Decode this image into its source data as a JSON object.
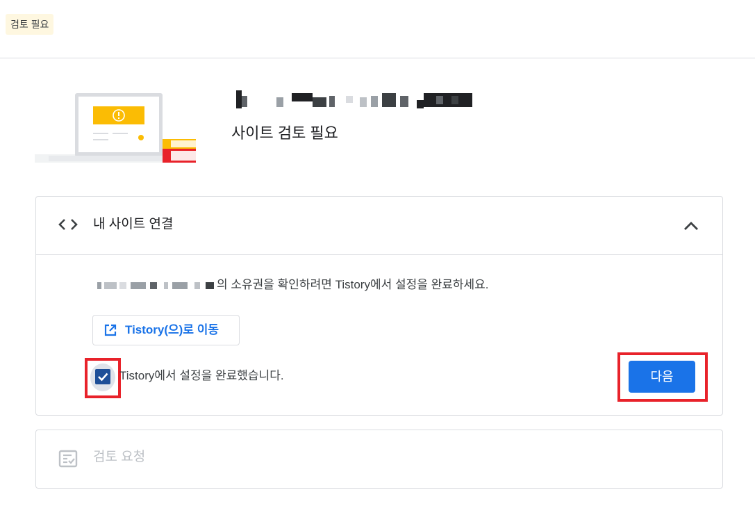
{
  "header": {
    "status_chip": "검토 필요"
  },
  "hero": {
    "title": "사이트 검토 필요",
    "illustration": "laptop-warning-with-books"
  },
  "connect_card": {
    "title": "내 사이트 연결",
    "icon": "code-icon",
    "collapse_icon": "chevron-up-icon",
    "instruction_suffix": "의 소유권을 확인하려면 Tistory에서 설정을 완료하세요.",
    "goto_button_label": "Tistory(으)로 이동",
    "checkbox_label": "Tistory에서 설정을 완료했습니다.",
    "checkbox_checked": true,
    "next_button_label": "다음"
  },
  "review_card": {
    "title": "검토 요청",
    "icon": "review-request-icon",
    "disabled": true
  },
  "colors": {
    "primary": "#1a73e8",
    "checkbox": "#1e4f98",
    "highlight": "#e8222a",
    "status_chip_bg": "#fef7e0",
    "warning": "#fbbc04",
    "disabled_text": "#bdc1c6"
  }
}
